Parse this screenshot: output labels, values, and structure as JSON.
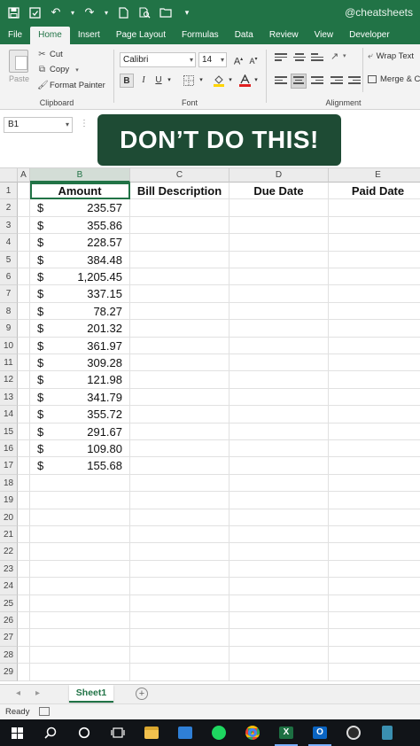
{
  "titlebar": {
    "handle": "@cheatsheets",
    "quick_access": [
      "save-icon",
      "autosave-icon",
      "undo-icon",
      "redo-icon",
      "new-file-icon",
      "print-preview-icon",
      "open-folder-icon",
      "customize-icon"
    ]
  },
  "tabs": [
    "File",
    "Home",
    "Insert",
    "Page Layout",
    "Formulas",
    "Data",
    "Review",
    "View",
    "Developer"
  ],
  "active_tab": "Home",
  "ribbon": {
    "clipboard": {
      "label": "Clipboard",
      "paste": "Paste",
      "cut": "Cut",
      "copy": "Copy",
      "format_painter": "Format Painter"
    },
    "font": {
      "label": "Font",
      "family": "Calibri",
      "size": "14",
      "bold": "B",
      "italic": "I",
      "underline": "U",
      "grow": "A",
      "shrink": "A"
    },
    "alignment": {
      "label": "Alignment",
      "wrap_text": "Wrap Text",
      "merge": "Merge & C"
    }
  },
  "formula_bar": {
    "name_box": "B1"
  },
  "banner": "DON’T DO THIS!",
  "sheet": {
    "columns": [
      "A",
      "B",
      "C",
      "D",
      "E"
    ],
    "selected_column": "B",
    "headers": {
      "B": "Amount",
      "C": "Bill Description",
      "D": "Due Date",
      "E": "Paid Date"
    },
    "currency_symbol": "$",
    "amounts": [
      "235.57",
      "355.86",
      "228.57",
      "384.48",
      "1,205.45",
      "337.15",
      "78.27",
      "201.32",
      "361.97",
      "309.28",
      "121.98",
      "341.79",
      "355.72",
      "291.67",
      "109.80",
      "155.68"
    ],
    "row_numbers": [
      "1",
      "2",
      "3",
      "4",
      "5",
      "6",
      "7",
      "8",
      "9",
      "10",
      "11",
      "12",
      "13",
      "14",
      "15",
      "16",
      "17",
      "18",
      "19",
      "20",
      "21",
      "22",
      "23",
      "24",
      "25",
      "26",
      "27",
      "28",
      "29"
    ]
  },
  "sheet_tabs": {
    "active": "Sheet1",
    "add": "+"
  },
  "status": {
    "text": "Ready"
  },
  "taskbar": [
    "windows-start-icon",
    "search-icon",
    "cortana-icon",
    "task-view-icon",
    "file-explorer-icon",
    "mail-icon",
    "spotify-icon",
    "chrome-icon",
    "excel-icon",
    "outlook-icon",
    "obs-icon",
    "app-icon"
  ],
  "colors": {
    "excel_green": "#217346",
    "banner_bg": "#1e4b34",
    "taskbar_bg": "#111418"
  }
}
